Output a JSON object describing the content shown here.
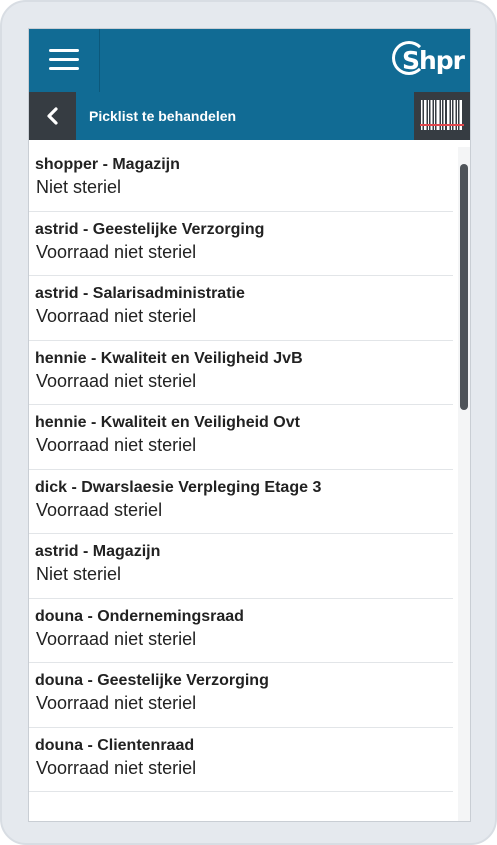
{
  "header": {
    "logo_text": "Shpr",
    "menu_icon": "hamburger-icon"
  },
  "subheader": {
    "title": "Picklist te behandelen",
    "back_icon": "chevron-left-icon",
    "scan_icon": "barcode-scanner-icon"
  },
  "colors": {
    "header_bg": "#116b94",
    "button_bg": "#363c42",
    "scan_line": "#e0474c"
  },
  "items": [
    {
      "title": "shopper - Magazijn",
      "subtitle": "Niet steriel"
    },
    {
      "title": "astrid - Geestelijke Verzorging",
      "subtitle": "Voorraad niet steriel"
    },
    {
      "title": "astrid - Salarisadministratie",
      "subtitle": "Voorraad niet steriel"
    },
    {
      "title": "hennie - Kwaliteit en Veiligheid JvB",
      "subtitle": "Voorraad niet steriel"
    },
    {
      "title": "hennie - Kwaliteit en Veiligheid Ovt",
      "subtitle": "Voorraad niet steriel"
    },
    {
      "title": "dick - Dwarslaesie Verpleging Etage 3",
      "subtitle": "Voorraad steriel"
    },
    {
      "title": "astrid - Magazijn",
      "subtitle": "Niet steriel"
    },
    {
      "title": "douna - Ondernemingsraad",
      "subtitle": "Voorraad niet steriel"
    },
    {
      "title": "douna - Geestelijke Verzorging",
      "subtitle": "Voorraad niet steriel"
    },
    {
      "title": "douna - Clientenraad",
      "subtitle": "Voorraad niet steriel"
    }
  ]
}
